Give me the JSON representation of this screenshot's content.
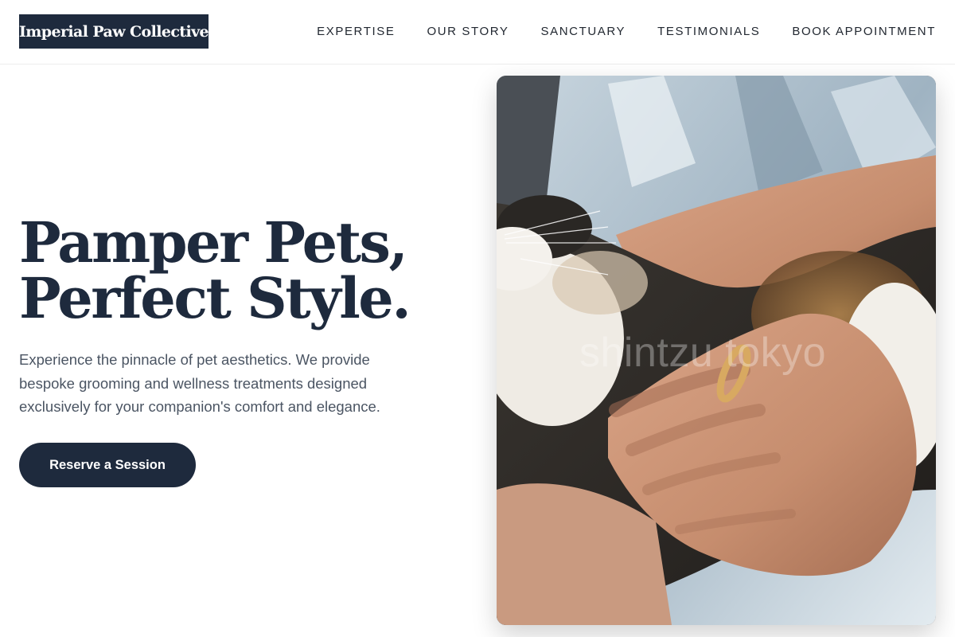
{
  "brand": {
    "name": "Imperial Paw Collective"
  },
  "nav": {
    "items": [
      {
        "label": "EXPERTISE"
      },
      {
        "label": "OUR STORY"
      },
      {
        "label": "SANCTUARY"
      },
      {
        "label": "TESTIMONIALS"
      },
      {
        "label": "BOOK APPOINTMENT"
      }
    ]
  },
  "hero": {
    "title_line1": "Pamper Pets,",
    "title_line2": "Perfect Style.",
    "subtitle": "Experience the pinnacle of pet aesthetics. We provide bespoke grooming and wellness treatments designed exclusively for your companion's comfort and elegance.",
    "cta_label": "Reserve a Session"
  },
  "photo": {
    "watermark": "shintzu tokyo",
    "subject": "hand-petting-calico-cat"
  },
  "colors": {
    "brand_navy": "#1e2a3d",
    "text_muted": "#4b5563",
    "nav_text": "#222831",
    "background": "#ffffff"
  }
}
